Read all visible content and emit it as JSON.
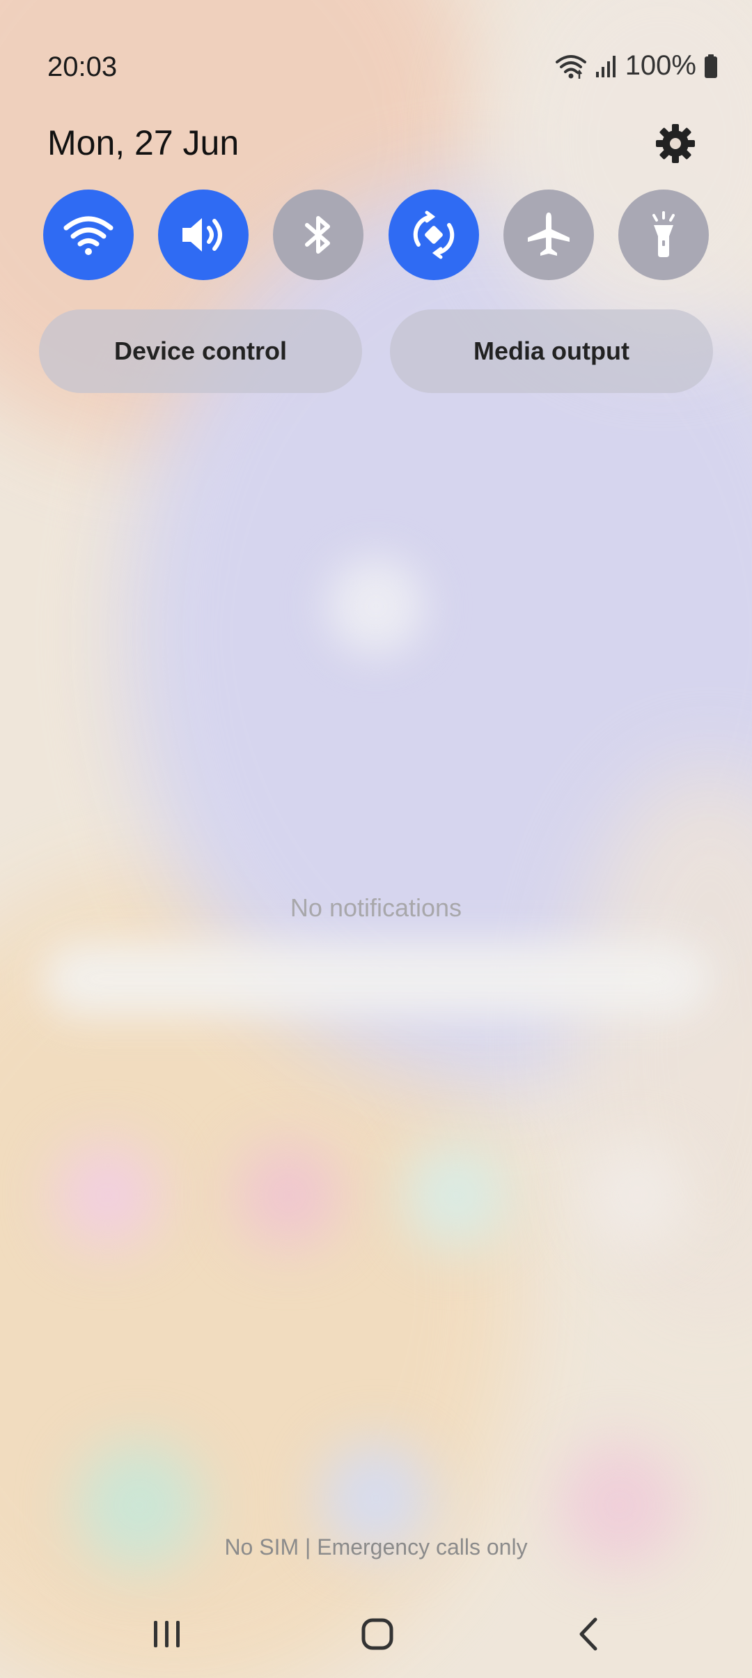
{
  "status_bar": {
    "time": "20:03",
    "battery_percent": "100%",
    "icons": [
      "wifi-icon",
      "cellular-signal-icon",
      "battery-icon"
    ]
  },
  "panel": {
    "date": "Mon, 27 Jun",
    "settings_icon": "gear-icon"
  },
  "quick_tiles": [
    {
      "name": "wifi",
      "icon": "wifi-icon",
      "state": "on"
    },
    {
      "name": "sound",
      "icon": "speaker-icon",
      "state": "on"
    },
    {
      "name": "bluetooth",
      "icon": "bluetooth-icon",
      "state": "off"
    },
    {
      "name": "auto-rotate",
      "icon": "auto-rotate-icon",
      "state": "on"
    },
    {
      "name": "airplane-mode",
      "icon": "airplane-icon",
      "state": "off"
    },
    {
      "name": "flashlight",
      "icon": "flashlight-icon",
      "state": "off"
    }
  ],
  "buttons": {
    "device_control": "Device control",
    "media_output": "Media output"
  },
  "notifications": {
    "empty_text": "No notifications"
  },
  "footer": {
    "sim_status": "No SIM | Emergency calls only"
  },
  "nav_bar": {
    "icons": [
      "recent-apps-icon",
      "home-icon",
      "back-icon"
    ]
  },
  "colors": {
    "tile_on": "#2f6bf3",
    "tile_off": "#a9a8b4"
  }
}
